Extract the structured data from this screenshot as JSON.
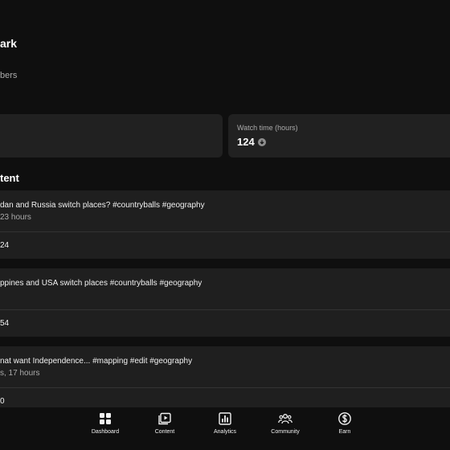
{
  "channel": {
    "name": "ark",
    "subscribers": "bers"
  },
  "stats": {
    "watch_time_label": "Watch time (hours)",
    "watch_time_value": "124"
  },
  "section": {
    "title": "tent"
  },
  "videos": [
    {
      "title": "dan and Russia switch places? #countryballs  #geography",
      "meta": "23 hours",
      "stat": "24"
    },
    {
      "title": "ppines and USA switch places #countryballs #geography",
      "meta": "",
      "stat": "54"
    },
    {
      "title": "nat want Independence... #mapping #edit #geography",
      "meta": "s, 17 hours",
      "stat": "0"
    }
  ],
  "nav": {
    "items": [
      {
        "label": "Dashboard",
        "icon": "dashboard-icon"
      },
      {
        "label": "Content",
        "icon": "content-icon"
      },
      {
        "label": "Analytics",
        "icon": "analytics-icon"
      },
      {
        "label": "Community",
        "icon": "community-icon"
      },
      {
        "label": "Earn",
        "icon": "earn-icon"
      }
    ]
  },
  "colors": {
    "background": "#0f0f0f",
    "card": "#212121",
    "text_primary": "#f1f1f1",
    "text_secondary": "#aaaaaa"
  }
}
